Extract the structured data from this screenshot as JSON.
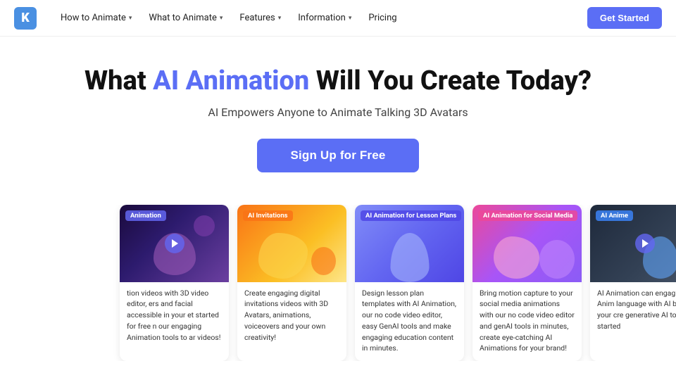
{
  "nav": {
    "logo_letter": "K",
    "items": [
      {
        "label": "How to Animate",
        "has_dropdown": true
      },
      {
        "label": "What to Animate",
        "has_dropdown": true
      },
      {
        "label": "Features",
        "has_dropdown": true
      },
      {
        "label": "Information",
        "has_dropdown": true
      },
      {
        "label": "Pricing",
        "has_dropdown": false
      }
    ],
    "cta_label": "Get Started"
  },
  "hero": {
    "title_prefix": "What ",
    "title_highlight": "AI Animation",
    "title_suffix": " Will You Create Today?",
    "subtitle": "AI Empowers Anyone to Animate Talking 3D Avatars",
    "signup_label": "Sign Up for Free"
  },
  "cards": [
    {
      "label": "Animation",
      "label_color": "label-purple",
      "description": "tion videos with 3D video editor, ers and facial accessible in your et started for free n our engaging Animation tools to ar videos!"
    },
    {
      "label": "AI Invitations",
      "label_color": "label-orange",
      "description": "Create engaging digital invitations videos with 3D Avatars, animations, voiceovers and your own creativity!"
    },
    {
      "label": "AI Animation for Lesson Plans",
      "label_color": "label-indigo",
      "description": "Design lesson plan templates with AI Animation, our no code video editor, easy GenAI tools and make engaging education content in minutes."
    },
    {
      "label": "AI Animation for Social Media",
      "label_color": "label-pink",
      "description": "Bring motion capture to your social media animations with our no code video editor and genAI tools in minutes, create eye-catching AI Animations for your brand!"
    },
    {
      "label": "AI Anime",
      "label_color": "label-blue",
      "description": "AI Animation can engaging Anim language with AI bring your cre generative AI tool started"
    }
  ]
}
